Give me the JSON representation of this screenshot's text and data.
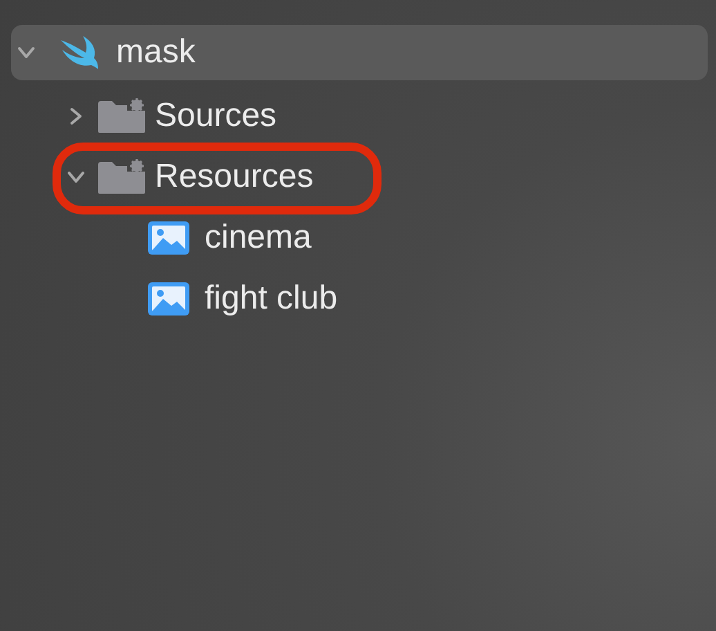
{
  "tree": [
    {
      "label": "mask",
      "kind": "swift",
      "expanded": true,
      "selected": true,
      "annotated": false,
      "children": [
        {
          "label": "Sources",
          "kind": "folder",
          "expanded": false,
          "selected": false,
          "annotated": false
        },
        {
          "label": "Resources",
          "kind": "folder",
          "expanded": true,
          "selected": false,
          "annotated": true,
          "children": [
            {
              "label": "cinema",
              "kind": "image",
              "selected": false,
              "annotated": false
            },
            {
              "label": "fight club",
              "kind": "image",
              "selected": false,
              "annotated": false
            }
          ]
        }
      ]
    }
  ]
}
